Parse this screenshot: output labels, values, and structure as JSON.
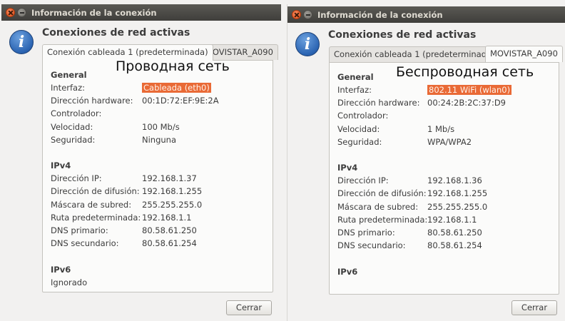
{
  "dialog_title": "Información de la conexión",
  "heading": "Conexiones de red activas",
  "info_icon_glyph": "i",
  "tabs": [
    "Conexión cableada 1 (predeterminada)",
    "MOVISTAR_A090"
  ],
  "labels": {
    "general": "General",
    "interface": "Interfaz:",
    "hw_address": "Dirección hardware:",
    "driver": "Controlador:",
    "speed": "Velocidad:",
    "security": "Seguridad:",
    "ipv4": "IPv4",
    "ip": "Dirección IP:",
    "broadcast": "Dirección de difusión:",
    "netmask": "Máscara de subred:",
    "route": "Ruta predeterminada:",
    "dns1": "DNS primario:",
    "dns2": "DNS secundario:",
    "ipv6": "IPv6"
  },
  "close_label": "Cerrar",
  "wired": {
    "caption": "Проводная сеть",
    "interface": "Cableada (eth0)",
    "hw_address": "00:1D:72:EF:9E:2A",
    "speed": "100 Mb/s",
    "security": "Ninguna",
    "ip": "192.168.1.37",
    "broadcast": "192.168.1.255",
    "netmask": "255.255.255.0",
    "route": "192.168.1.1",
    "dns1": "80.58.61.250",
    "dns2": "80.58.61.254",
    "ipv6_value": "Ignorado"
  },
  "wireless": {
    "caption": "Беспроводная сеть",
    "interface": "802.11 WiFi (wlan0)",
    "hw_address": "00:24:2B:2C:37:D9",
    "speed": "1 Mb/s",
    "security": "WPA/WPA2",
    "ip": "192.168.1.36",
    "broadcast": "192.168.1.255",
    "netmask": "255.255.255.0",
    "route": "192.168.1.1",
    "dns1": "80.58.61.250",
    "dns2": "80.58.61.254"
  },
  "colors": {
    "titlebar": "#4a4945",
    "highlight": "#e96a36",
    "close_button": "#df4b16",
    "info_icon": "#2b64b2"
  }
}
